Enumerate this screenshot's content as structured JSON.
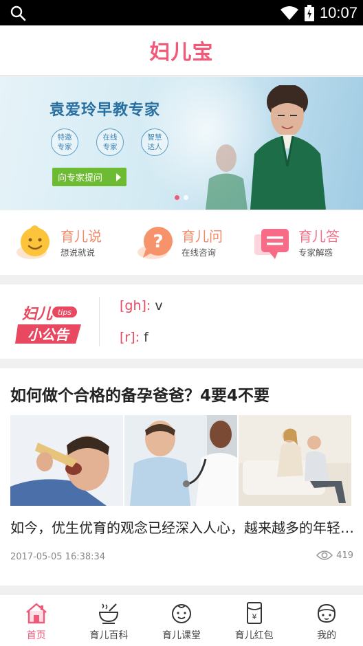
{
  "status_bar": {
    "time": "10:07"
  },
  "header": {
    "logo_text": "妇儿宝",
    "brand_color": "#f25877"
  },
  "banner": {
    "title": "袁爱玲早教专家",
    "badges": [
      {
        "line1": "特邀",
        "line2": "专家"
      },
      {
        "line1": "在线",
        "line2": "专家"
      },
      {
        "line1": "智慧",
        "line2": "达人"
      }
    ],
    "button_label": "向专家提问",
    "slide_count": 2,
    "active_slide": 1
  },
  "quick_links": [
    {
      "title": "育儿说",
      "subtitle": "想说就说",
      "icon": "smiley-icon"
    },
    {
      "title": "育儿问",
      "subtitle": "在线咨询",
      "icon": "question-bubble-icon"
    },
    {
      "title": "育儿答",
      "subtitle": "专家解惑",
      "icon": "answer-bubble-icon"
    }
  ],
  "notice": {
    "logo_line1": "妇儿",
    "logo_tips": "tips",
    "logo_line2": "小公告",
    "items": [
      {
        "tag": "[gh]:",
        "text": " v"
      },
      {
        "tag": "[r]:",
        "text": " f"
      }
    ]
  },
  "article": {
    "title": "如何做个合格的备孕爸爸？4要4不要",
    "description": "如今，优生优育的观念已经深入人心，越来越多的年轻夫妇都开始重视备孕",
    "date": "2017-05-05 16:38:34",
    "views": "419",
    "image_icons": [
      "man-eating-photo",
      "doctor-checkup-photo",
      "couple-sofa-photo"
    ]
  },
  "bottom_nav": [
    {
      "label": "首页",
      "icon": "home-icon",
      "active": true
    },
    {
      "label": "育儿百科",
      "icon": "bowl-icon",
      "active": false
    },
    {
      "label": "育儿课堂",
      "icon": "baby-face-icon",
      "active": false
    },
    {
      "label": "育儿红包",
      "icon": "red-envelope-icon",
      "active": false
    },
    {
      "label": "我的",
      "icon": "profile-icon",
      "active": false
    }
  ]
}
